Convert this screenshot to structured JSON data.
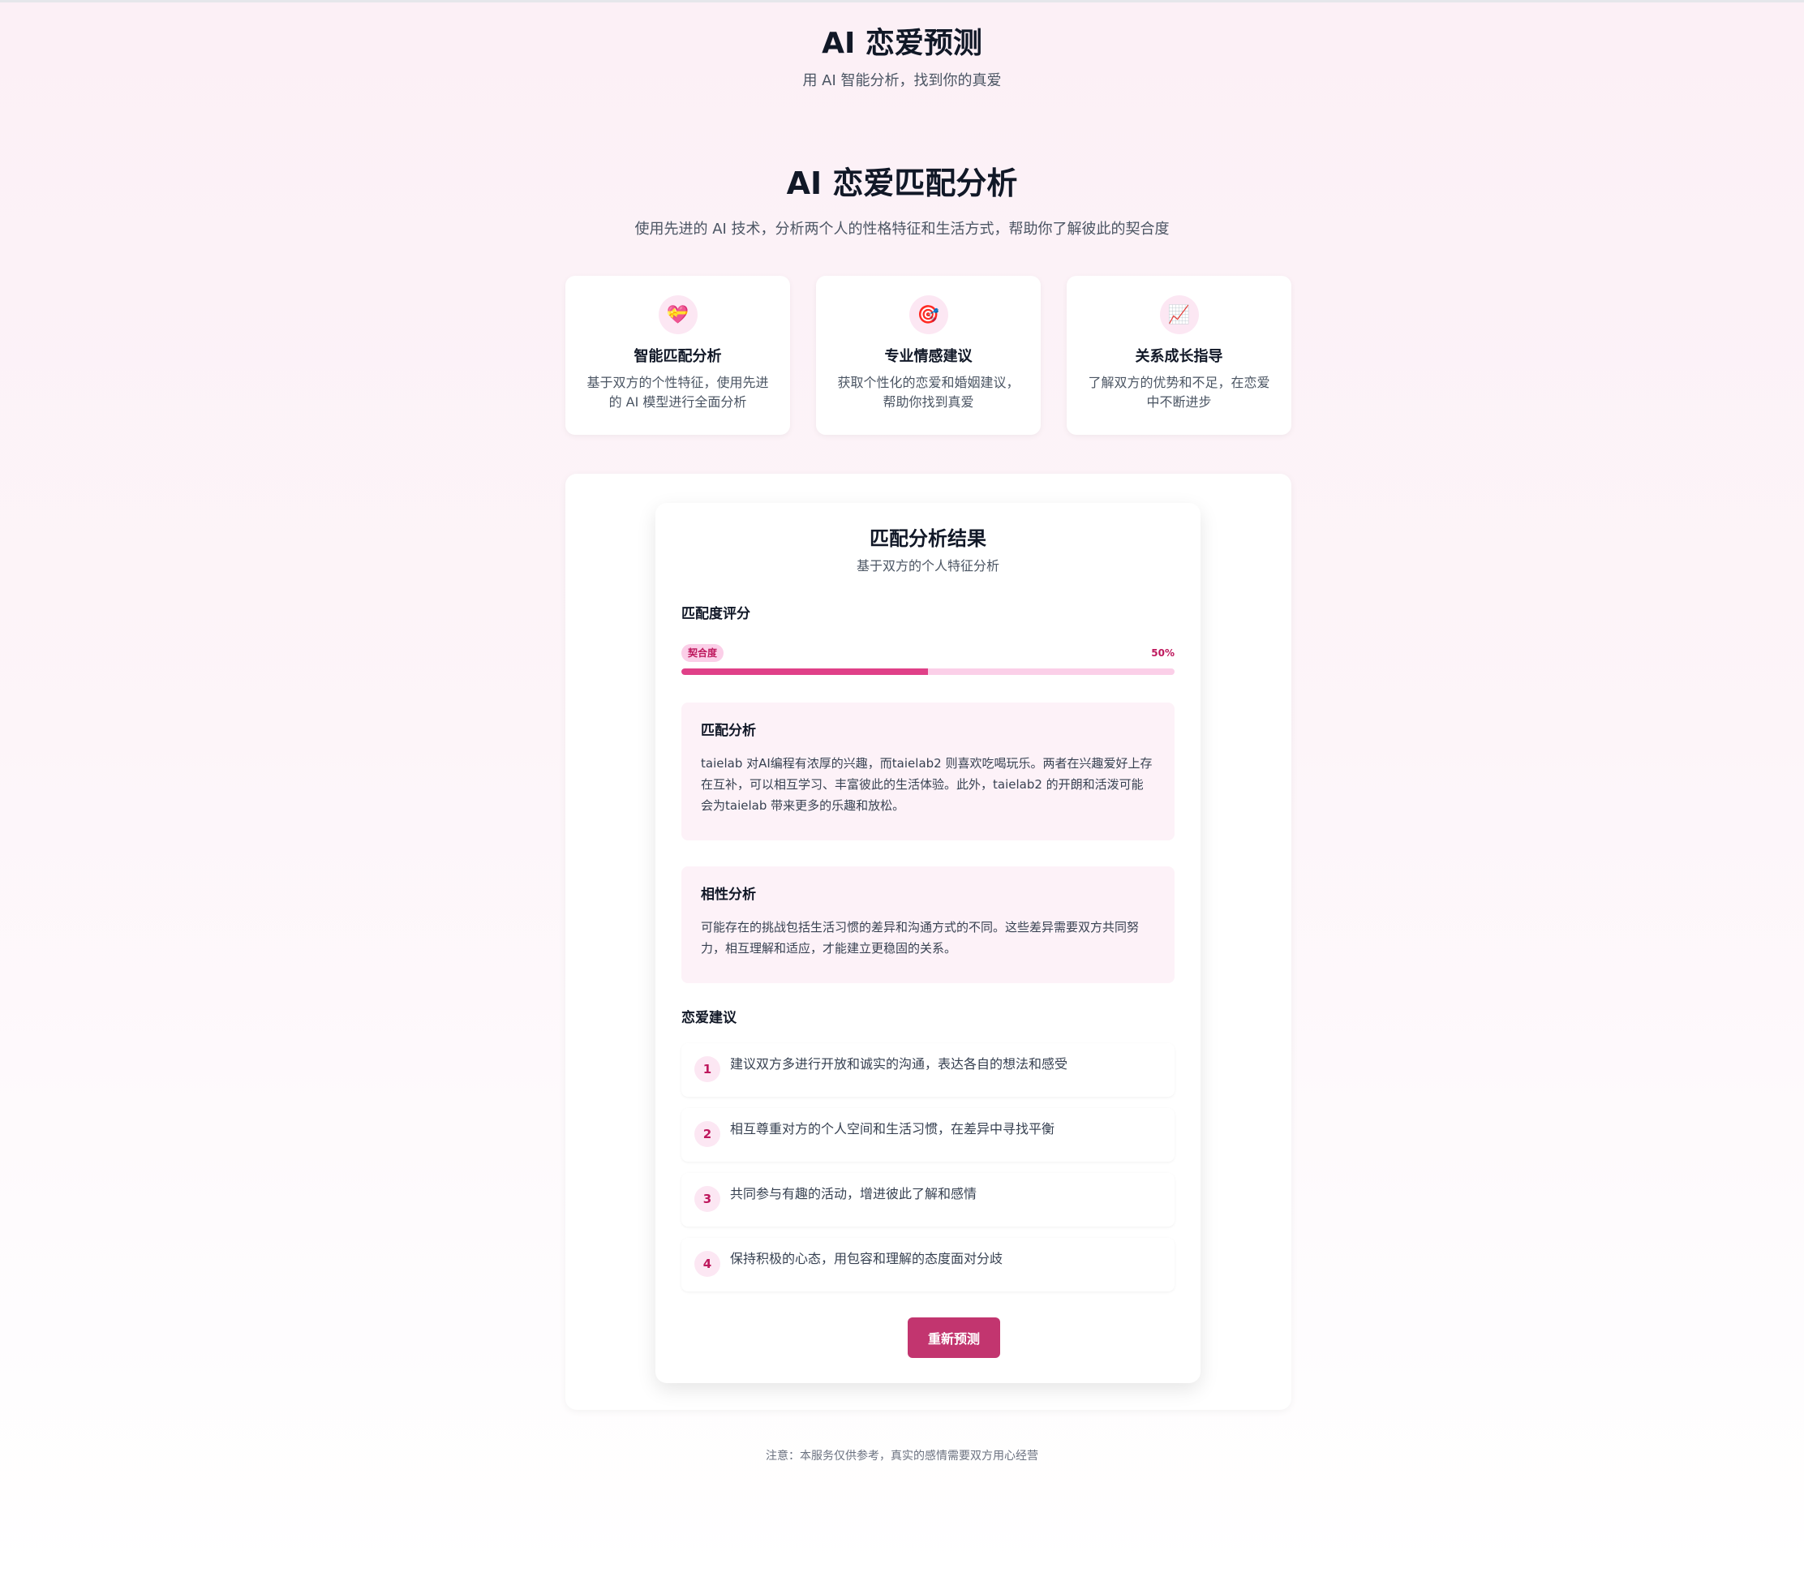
{
  "header": {
    "title": "AI 恋爱预测",
    "subtitle": "用 AI 智能分析，找到你的真爱"
  },
  "hero": {
    "title": "AI 恋爱匹配分析",
    "subtitle": "使用先进的 AI 技术，分析两个人的性格特征和生活方式，帮助你了解彼此的契合度"
  },
  "features": [
    {
      "icon": "💝",
      "icon_name": "heart-gift-icon",
      "title": "智能匹配分析",
      "desc": "基于双方的个性特征，使用先进的 AI 模型进行全面分析"
    },
    {
      "icon": "🎯",
      "icon_name": "target-icon",
      "title": "专业情感建议",
      "desc": "获取个性化的恋爱和婚姻建议，帮助你找到真爱"
    },
    {
      "icon": "📈",
      "icon_name": "chart-up-icon",
      "title": "关系成长指导",
      "desc": "了解双方的优势和不足，在恋爱中不断进步"
    }
  ],
  "result": {
    "title": "匹配分析结果",
    "subtitle": "基于双方的个人特征分析",
    "score_heading": "匹配度评分",
    "score_badge": "契合度",
    "score_value": "50%",
    "score_fraction": 0.5,
    "match_analysis": {
      "title": "匹配分析",
      "text": "taielab 对AI编程有浓厚的兴趣，而taielab2 则喜欢吃喝玩乐。两者在兴趣爱好上存在互补，可以相互学习、丰富彼此的生活体验。此外，taielab2 的开朗和活泼可能会为taielab 带来更多的乐趣和放松。"
    },
    "compat_analysis": {
      "title": "相性分析",
      "text": "可能存在的挑战包括生活习惯的差异和沟通方式的不同。这些差异需要双方共同努力，相互理解和适应，才能建立更稳固的关系。"
    },
    "advice_heading": "恋爱建议",
    "advice": [
      {
        "num": "1",
        "text": "建议双方多进行开放和诚实的沟通，表达各自的想法和感受"
      },
      {
        "num": "2",
        "text": "相互尊重对方的个人空间和生活习惯，在差异中寻找平衡"
      },
      {
        "num": "3",
        "text": "共同参与有趣的活动，增进彼此了解和感情"
      },
      {
        "num": "4",
        "text": "保持积极的心态，用包容和理解的态度面对分歧"
      }
    ],
    "retry_label": "重新预测"
  },
  "footer": {
    "note": "注意：本服务仅供参考，真实的感情需要双方用心经营"
  },
  "colors": {
    "accent": "#c2356f",
    "progress_fill": "#db2777",
    "progress_track": "#fbcfe8",
    "soft_pink": "#fdf2f8"
  }
}
